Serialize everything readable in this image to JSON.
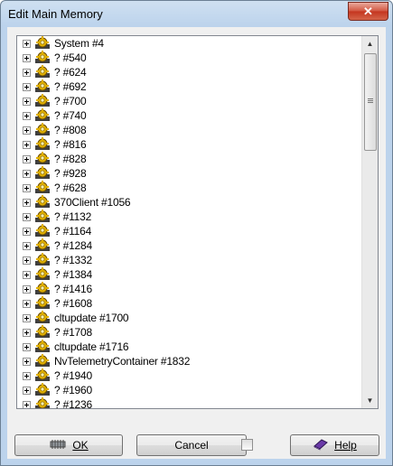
{
  "window": {
    "title": "Edit Main Memory",
    "close_label": "✕"
  },
  "tree": {
    "items": [
      "System #4",
      "? #540",
      "? #624",
      "? #692",
      "? #700",
      "? #740",
      "? #808",
      "? #816",
      "? #828",
      "? #928",
      "? #628",
      "370Client #1056",
      "? #1132",
      "? #1164",
      "? #1284",
      "? #1332",
      "? #1384",
      "? #1416",
      "? #1608",
      "cltupdate #1700",
      "? #1708",
      "cltupdate #1716",
      "NvTelemetryContainer #1832",
      "? #1940",
      "? #1960",
      "? #1236"
    ]
  },
  "buttons": {
    "ok": "OK",
    "cancel": "Cancel",
    "help": "Help"
  },
  "icons": {
    "tree_item": "gear-icon",
    "expander": "plus-box-icon",
    "ok": "chip-icon",
    "help": "book-icon"
  },
  "colors": {
    "title_bg": "#bcd3ec",
    "close_bg": "#c4341e",
    "icon_gold": "#e0b000"
  }
}
